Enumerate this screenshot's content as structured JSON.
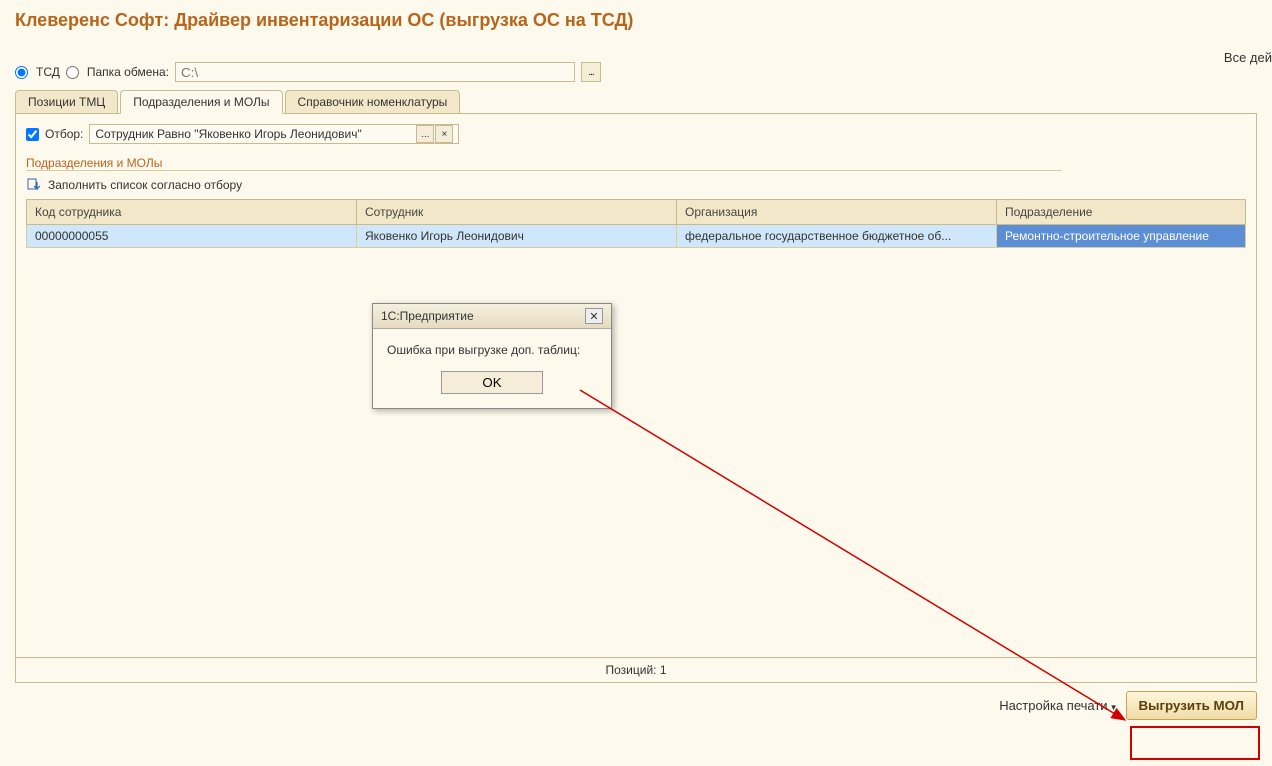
{
  "page": {
    "title": "Клеверенс Софт: Драйвер инвентаризации ОС (выгрузка ОС на ТСД)",
    "top_right": "Все дей"
  },
  "radio": {
    "tsd_label": "ТСД",
    "folder_label": "Папка обмена:",
    "path_placeholder": "C:\\"
  },
  "tabs": {
    "tmc": "Позиции ТМЦ",
    "mol": "Подразделения и МОЛы",
    "nomen": "Справочник номенклатуры"
  },
  "filter": {
    "label": "Отбор:",
    "value": "Сотрудник Равно \"Яковенко Игорь Леонидович\""
  },
  "group": {
    "title": "Подразделения и МОЛы",
    "fill_label": "Заполнить список согласно отбору"
  },
  "table": {
    "headers": {
      "code": "Код сотрудника",
      "employee": "Сотрудник",
      "org": "Организация",
      "dept": "Подразделение"
    },
    "rows": [
      {
        "code": "00000000055",
        "employee": "Яковенко Игорь Леонидович",
        "org": "федеральное государственное бюджетное об...",
        "dept": "Ремонтно-строительное управление"
      }
    ]
  },
  "status": "Позиций: 1",
  "footer": {
    "print": "Настройка печати",
    "export": "Выгрузить МОЛ"
  },
  "dialog": {
    "title": "1С:Предприятие",
    "message": "Ошибка при выгрузке доп. таблиц:",
    "ok": "OK"
  }
}
